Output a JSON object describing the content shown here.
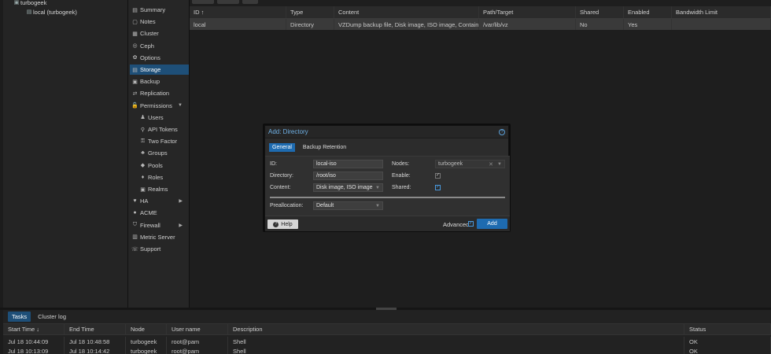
{
  "tree": {
    "node": "turbogeek",
    "storage": "local (turbogeek)"
  },
  "nav": {
    "items": [
      {
        "icon": "summary-icon",
        "glyph": "▤",
        "label": "Summary"
      },
      {
        "icon": "notes-icon",
        "glyph": "▢",
        "label": "Notes"
      },
      {
        "icon": "cluster-icon",
        "glyph": "▦",
        "label": "Cluster"
      },
      {
        "icon": "ceph-icon",
        "glyph": "◎",
        "label": "Ceph"
      },
      {
        "icon": "options-icon",
        "glyph": "✿",
        "label": "Options"
      },
      {
        "icon": "storage-icon",
        "glyph": "▤",
        "label": "Storage",
        "selected": true
      },
      {
        "icon": "backup-icon",
        "glyph": "▣",
        "label": "Backup"
      },
      {
        "icon": "replication-icon",
        "glyph": "⇄",
        "label": "Replication"
      },
      {
        "icon": "permissions-icon",
        "glyph": "🔓",
        "label": "Permissions",
        "expand": "▼"
      },
      {
        "icon": "users-icon",
        "glyph": "♟",
        "label": "Users",
        "sub": true
      },
      {
        "icon": "api-tokens-icon",
        "glyph": "⚲",
        "label": "API Tokens",
        "sub": true
      },
      {
        "icon": "two-factor-icon",
        "glyph": "⚿",
        "label": "Two Factor",
        "sub": true
      },
      {
        "icon": "groups-icon",
        "glyph": "♣",
        "label": "Groups",
        "sub": true
      },
      {
        "icon": "pools-icon",
        "glyph": "◆",
        "label": "Pools",
        "sub": true
      },
      {
        "icon": "roles-icon",
        "glyph": "♦",
        "label": "Roles",
        "sub": true
      },
      {
        "icon": "realms-icon",
        "glyph": "▣",
        "label": "Realms",
        "sub": true
      },
      {
        "icon": "ha-icon",
        "glyph": "♥",
        "label": "HA",
        "expand": "▶"
      },
      {
        "icon": "acme-icon",
        "glyph": "●",
        "label": "ACME"
      },
      {
        "icon": "firewall-icon",
        "glyph": "⛉",
        "label": "Firewall",
        "expand": "▶"
      },
      {
        "icon": "metric-server-icon",
        "glyph": "▥",
        "label": "Metric Server"
      },
      {
        "icon": "support-icon",
        "glyph": "☏",
        "label": "Support"
      }
    ]
  },
  "storage_grid": {
    "columns": [
      {
        "label": "ID ↑",
        "w": 123
      },
      {
        "label": "Type",
        "w": 61
      },
      {
        "label": "Content",
        "w": 184
      },
      {
        "label": "Path/Target",
        "w": 123
      },
      {
        "label": "Shared",
        "w": 61
      },
      {
        "label": "Enabled",
        "w": 61
      },
      {
        "label": "Bandwidth Limit",
        "w": 126
      }
    ],
    "rows": [
      [
        "local",
        "Directory",
        "VZDump backup file, Disk image, ISO image, Containe...",
        "/var/lib/vz",
        "No",
        "Yes",
        ""
      ]
    ]
  },
  "dialog": {
    "title": "Add: Directory",
    "help_glyph": "?",
    "tabs": [
      "General",
      "Backup Retention"
    ],
    "fields": {
      "id_label": "ID:",
      "id_value": "local-iso",
      "directory_label": "Directory:",
      "directory_value": "/root/iso",
      "content_label": "Content:",
      "content_value": "Disk image, ISO image",
      "nodes_label": "Nodes:",
      "nodes_value": "turbogeek",
      "enable_label": "Enable:",
      "shared_label": "Shared:",
      "preallocation_label": "Preallocation:",
      "preallocation_value": "Default"
    },
    "enable_checked": true,
    "shared_checked": true,
    "help_label": "Help",
    "advanced_label": "Advanced",
    "advanced_checked": true,
    "add_label": "Add"
  },
  "bottom": {
    "tabs": [
      "Tasks",
      "Cluster log"
    ],
    "columns": [
      {
        "label": "Start Time ↓",
        "w": 78
      },
      {
        "label": "End Time",
        "w": 78
      },
      {
        "label": "Node",
        "w": 52
      },
      {
        "label": "User name",
        "w": 78
      },
      {
        "label": "Description",
        "w": 580
      },
      {
        "label": "Status",
        "w": 110
      }
    ],
    "rows": [
      [
        "Jul 18 10:44:09",
        "Jul 18 10:48:58",
        "turbogeek",
        "root@pam",
        "Shell",
        "OK"
      ],
      [
        "Jul 18 10:13:09",
        "Jul 18 10:14:42",
        "turbogeek",
        "root@pam",
        "Shell",
        "OK"
      ]
    ]
  }
}
